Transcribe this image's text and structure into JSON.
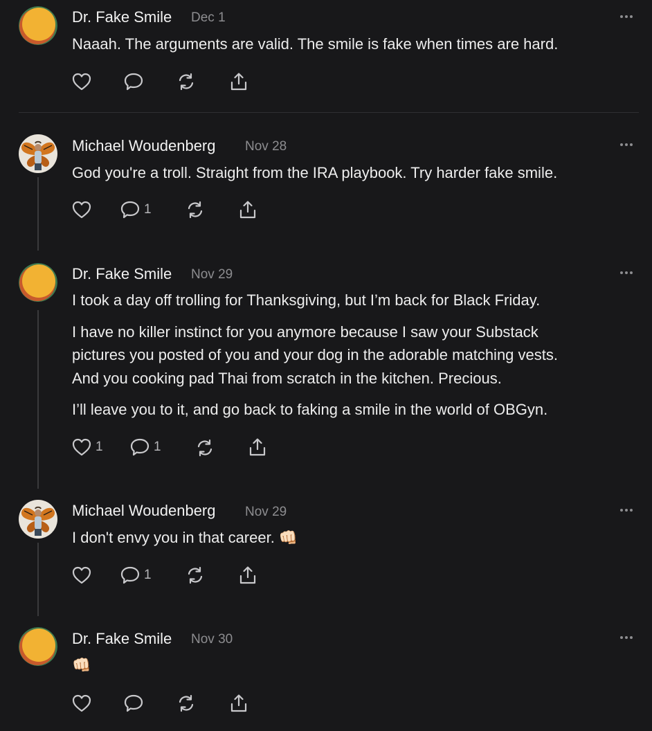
{
  "colors": {
    "background": "#18181a",
    "text": "#eeeeee",
    "muted": "#8d8d90",
    "icon": "#c9c9cc"
  },
  "comments": [
    {
      "author": "Dr. Fake Smile",
      "date": "Dec 1",
      "avatar": "orange-circle-logo",
      "paragraphs": [
        "Naaah. The arguments are valid. The smile is fake when times are hard."
      ],
      "likes": "",
      "replies": ""
    },
    {
      "author": "Michael Woudenberg",
      "date": "Nov 28",
      "avatar": "butterfly-wings-photo",
      "paragraphs": [
        "God you're a troll. Straight from the IRA playbook. Try harder fake smile."
      ],
      "likes": "",
      "replies": "1"
    },
    {
      "author": "Dr. Fake Smile",
      "date": "Nov 29",
      "avatar": "orange-circle-logo",
      "paragraphs": [
        "I took a day off trolling for Thanksgiving, but I’m back for Black Friday.",
        "I have no killer instinct for you anymore because I saw your Substack",
        "pictures you posted of you and your dog in the adorable matching vests.",
        "And you cooking pad Thai from scratch in the kitchen. Precious.",
        "I’ll leave you to it, and go back to faking a smile in the world of OBGyn."
      ],
      "likes": "1",
      "replies": "1"
    },
    {
      "author": "Michael Woudenberg",
      "date": "Nov 29",
      "avatar": "butterfly-wings-photo",
      "paragraphs": [
        "I don't envy you in that career. 👊🏻"
      ],
      "likes": "",
      "replies": "1"
    },
    {
      "author": "Dr. Fake Smile",
      "date": "Nov 30",
      "avatar": "orange-circle-logo",
      "paragraphs": [
        "👊🏻"
      ],
      "likes": "",
      "replies": ""
    }
  ]
}
